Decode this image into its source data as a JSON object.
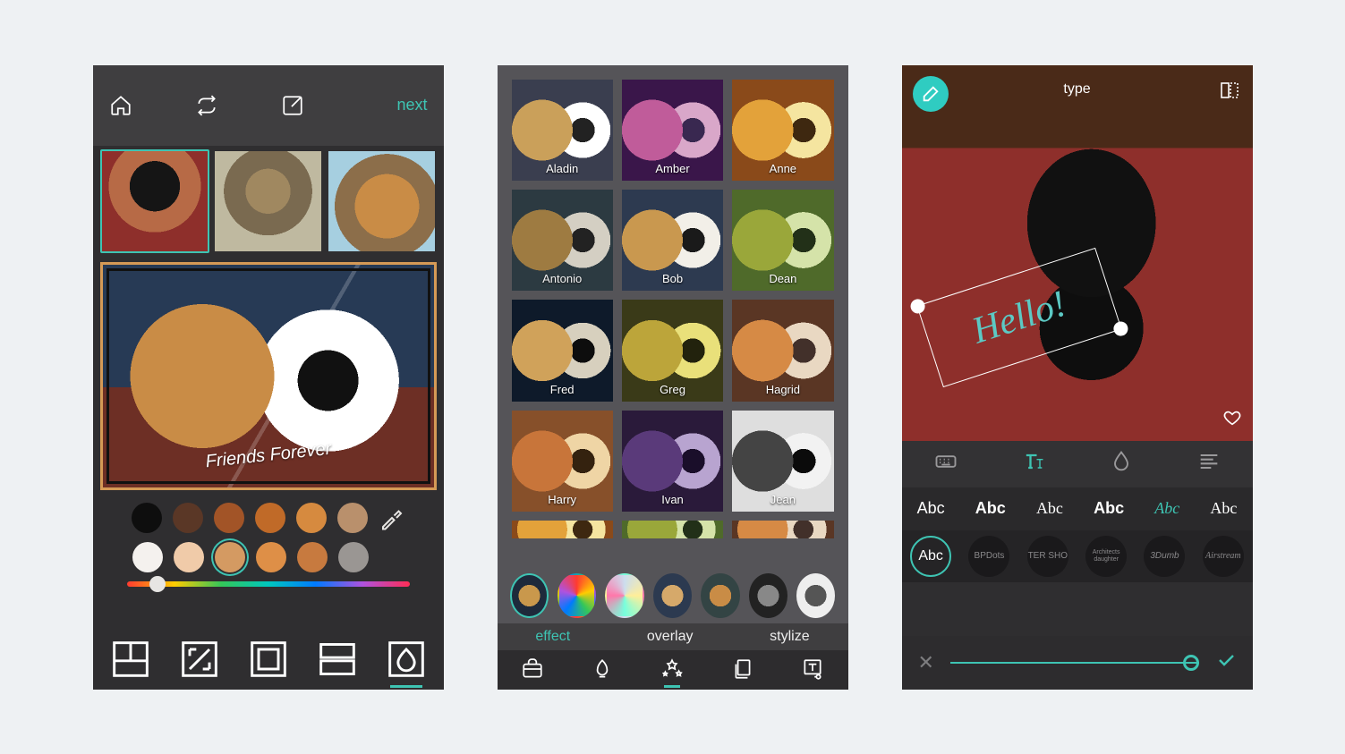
{
  "screen1": {
    "next_label": "next",
    "palette_row1": [
      "#0e0e0e",
      "#5a3726",
      "#a25427",
      "#c06a28",
      "#d68a3f",
      "#b9906c"
    ],
    "palette_row2": [
      "#f4f1ee",
      "#f0cba9",
      "#d49a62",
      "#de8f47",
      "#c77a3f",
      "#9a9693"
    ],
    "caption": "Friends Forever"
  },
  "screen2": {
    "filters": [
      "Aladin",
      "Amber",
      "Anne",
      "Antonio",
      "Bob",
      "Dean",
      "Fred",
      "Greg",
      "Hagrid",
      "Harry",
      "Ivan",
      "Jean"
    ],
    "tabs": {
      "effect": "effect",
      "overlay": "overlay",
      "stylize": "stylize"
    }
  },
  "screen3": {
    "title": "type",
    "text_content": "Hello!",
    "font_sample": "Abc",
    "font_circle_labels": [
      "Abc",
      "BPDots",
      "TER SHO",
      "Architects daughter",
      "3Dumb",
      "Airstream"
    ]
  }
}
